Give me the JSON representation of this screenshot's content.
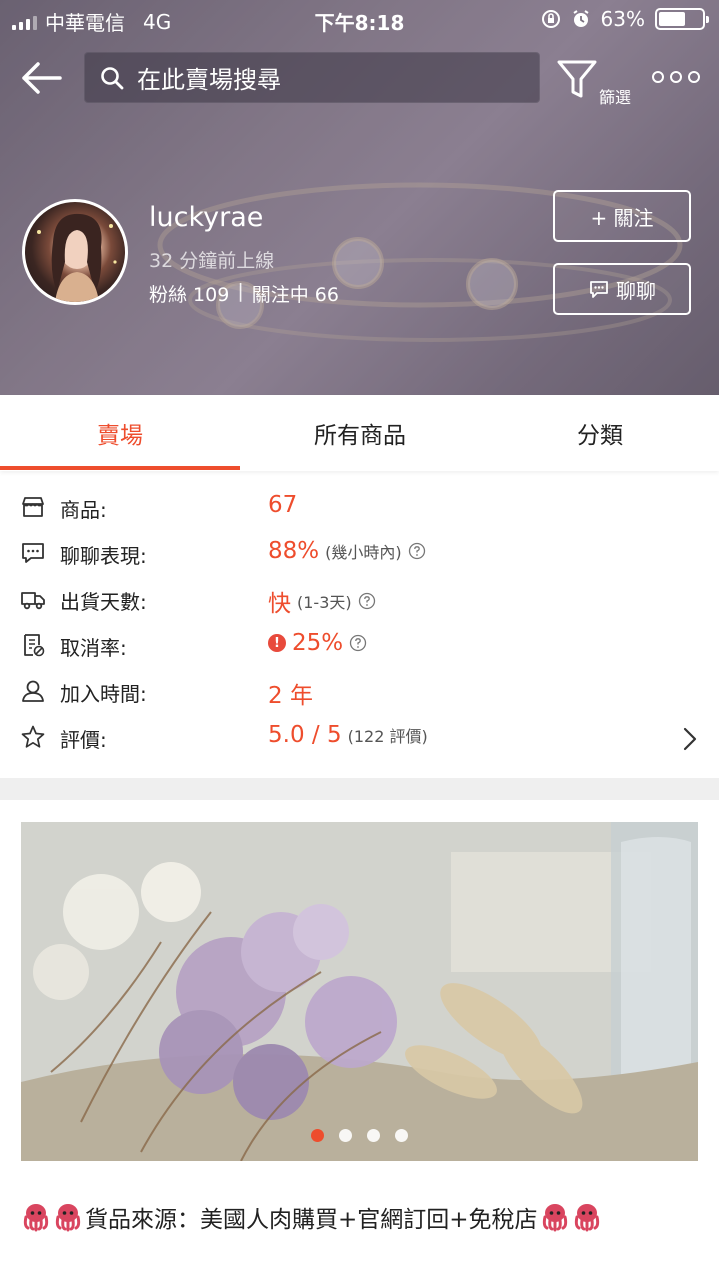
{
  "status_bar": {
    "carrier": "中華電信",
    "network": "4G",
    "time": "下午8:18",
    "battery_percent": "63%",
    "battery_level": 0.63
  },
  "top_nav": {
    "search_placeholder": "在此賣場搜尋",
    "filter_label": "篩選"
  },
  "profile": {
    "username": "luckyrae",
    "online_status": "32 分鐘前上線",
    "followers": "粉絲 109",
    "separator": "|",
    "following": "關注中 66",
    "follow_button": "+ 關注",
    "chat_button": "聊聊"
  },
  "tabs": [
    {
      "label": "賣場",
      "active": true
    },
    {
      "label": "所有商品",
      "active": false
    },
    {
      "label": "分類",
      "active": false
    }
  ],
  "stats": {
    "products": {
      "label": "商品:",
      "value": "67"
    },
    "chat": {
      "label": "聊聊表現:",
      "value": "88%",
      "note": "(幾小時內)"
    },
    "shipping": {
      "label": "出貨天數:",
      "value": "快",
      "note": "(1-3天)"
    },
    "cancel": {
      "label": "取消率:",
      "value": "25%"
    },
    "joined": {
      "label": "加入時間:",
      "value": "2 年"
    },
    "rating": {
      "label": "評價:",
      "value": "5.0 / 5",
      "note": "(122 評價)"
    }
  },
  "banner": {
    "slide_count": 4,
    "active_slide": 1
  },
  "description": {
    "text": "貨品來源：美國人肉購買+官網訂回+免稅店"
  },
  "colors": {
    "accent": "#ee4d2d",
    "warning": "#e84a3c"
  }
}
